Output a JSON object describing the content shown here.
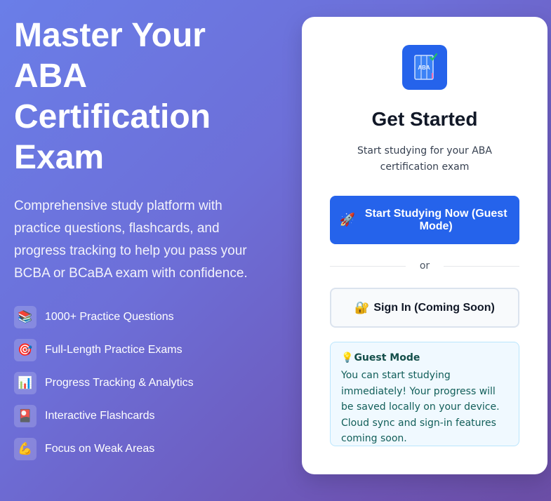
{
  "hero": {
    "title": "Master Your ABA Certification Exam",
    "description": "Comprehensive study platform with practice questions, flashcards, and progress tracking to help you pass your BCBA or BCaBA exam with confidence."
  },
  "features": [
    {
      "icon": "books-icon",
      "emoji": "📚",
      "label": "1000+ Practice Questions"
    },
    {
      "icon": "target-icon",
      "emoji": "🎯",
      "label": "Full-Length Practice Exams"
    },
    {
      "icon": "bar-chart-icon",
      "emoji": "📊",
      "label": "Progress Tracking & Analytics"
    },
    {
      "icon": "flashcard-icon",
      "emoji": "🎴",
      "label": "Interactive Flashcards"
    },
    {
      "icon": "flexed-biceps-icon",
      "emoji": "💪",
      "label": "Focus on Weak Areas"
    }
  ],
  "card": {
    "logo_text": "ABA",
    "title": "Get Started",
    "subtitle": "Start studying for your ABA certification exam",
    "primary_button": {
      "icon": "🚀",
      "label": "Start Studying Now (Guest Mode)"
    },
    "divider_text": "or",
    "secondary_button": {
      "icon": "🔐",
      "label": "Sign In (Coming Soon)"
    },
    "info": {
      "icon": "💡",
      "title": "Guest Mode",
      "text": "You can start studying immediately! Your progress will be saved locally on your device. Cloud sync and sign-in features coming soon."
    }
  },
  "colors": {
    "accent": "#2563eb",
    "info_bg": "#f0f9ff",
    "info_border": "#bae6fd"
  }
}
